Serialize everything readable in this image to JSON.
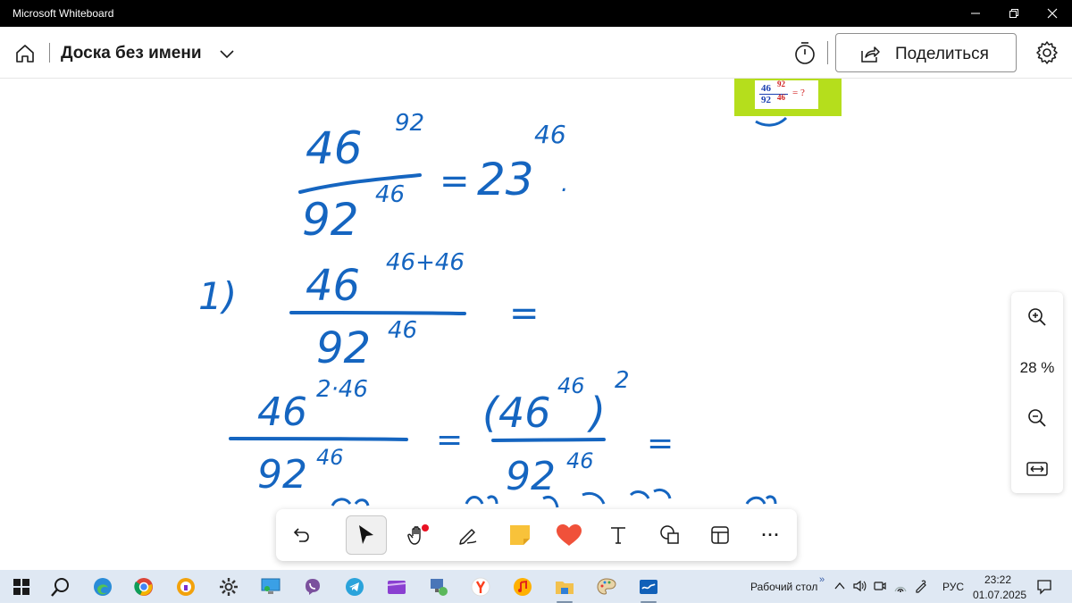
{
  "window": {
    "title": "Microsoft Whiteboard"
  },
  "appbar": {
    "board_name": "Доска без имени",
    "share_label": "Поделиться"
  },
  "canvas": {
    "thumbnail": {
      "base": "46",
      "exp": "92",
      "den_base": "92",
      "den_exp": "46",
      "suffix": "= ?"
    },
    "handwriting": {
      "line1": {
        "num": "46",
        "num_exp": "92",
        "den": "92",
        "den_exp": "46",
        "eq": "=",
        "rhs": "23",
        "rhs_exp": "46",
        "dot": "."
      },
      "step": "1)",
      "line2": {
        "num": "46",
        "num_exp": "46+46",
        "den": "92",
        "den_exp": "46",
        "eq": "="
      },
      "line3": {
        "num": "46",
        "num_exp": "2·46",
        "den": "92",
        "den_exp": "46",
        "eq1": "=",
        "paren_base": "(46",
        "paren_inner_exp": "46",
        "paren_close": ")",
        "paren_exp": "2",
        "den2": "92",
        "den2_exp": "46",
        "eq2": "="
      }
    }
  },
  "zoom": {
    "level": "28 %"
  },
  "toolbar": {
    "tools": [
      "undo-icon",
      "select-icon",
      "pan-icon",
      "pen-icon",
      "sticky-note-icon",
      "reactions-icon",
      "text-icon",
      "shapes-icon",
      "templates-icon",
      "more-icon"
    ],
    "selected": "select-icon",
    "more_label": "···"
  },
  "taskbar": {
    "desktop_label": "Рабочий стол",
    "lang": "РУС",
    "time": "23:22",
    "date": "01.07.2025",
    "chevron": "»"
  },
  "colors": {
    "ink": "#1565c0",
    "thumb_bg": "#b5de1c",
    "taskbar": "#dfe8f3",
    "reaction": "#f0513a"
  }
}
